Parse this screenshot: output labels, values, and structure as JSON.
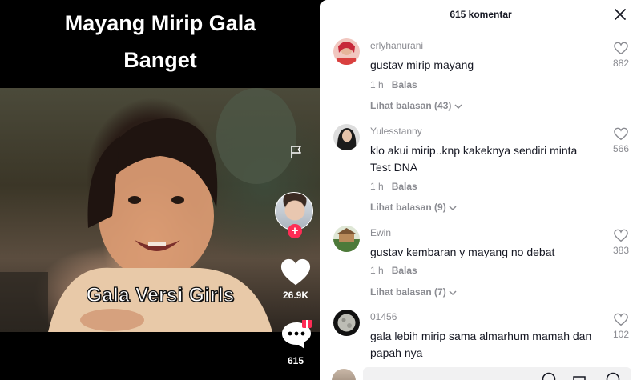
{
  "video": {
    "title_line1": "Mayang Mirip Gala",
    "title_line2": "Banget",
    "caption": "Gala Versi Girls",
    "like_count": "26.9K",
    "comment_count": "615",
    "icons": [
      "flag-icon",
      "heart-icon",
      "comment-icon",
      "plus-icon",
      "gift-icon"
    ],
    "accent_color": "#fe2c55"
  },
  "panel": {
    "title": "615 komentar",
    "close_icon": "close-icon"
  },
  "comments": [
    {
      "username": "erlyhanurani",
      "text": "gustav mirip mayang",
      "time": "1 h",
      "reply_label": "Balas",
      "replies_label": "Lihat balasan (43)",
      "likes": "882"
    },
    {
      "username": "Yulesstanny",
      "text": "klo akui mirip..knp kakeknya sendiri minta Test DNA",
      "time": "1 h",
      "reply_label": "Balas",
      "replies_label": "Lihat balasan (9)",
      "likes": "566"
    },
    {
      "username": "Ewin",
      "text": "gustav kembaran y mayang no debat",
      "time": "1 h",
      "reply_label": "Balas",
      "replies_label": "Lihat balasan (7)",
      "likes": "383"
    },
    {
      "username": "01456",
      "text": "gala lebih mirip sama almarhum mamah dan papah nya",
      "likes": "102"
    }
  ]
}
